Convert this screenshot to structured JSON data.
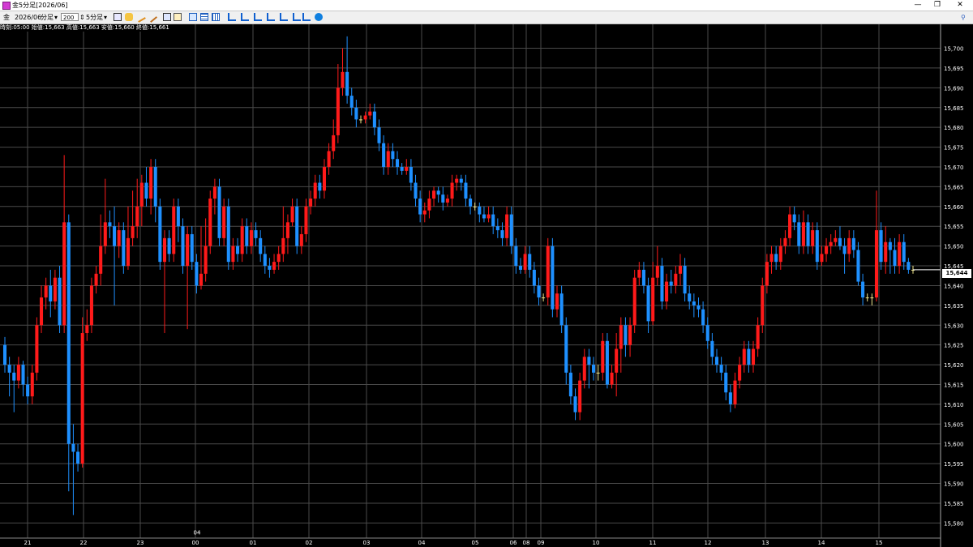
{
  "window": {
    "title": "金5分足[2026/06]",
    "minimize": "—",
    "restore": "❐",
    "close": "✕"
  },
  "toolbar": {
    "symbol": "金",
    "contract": "2026/06",
    "unit": "分足",
    "count": "200",
    "timeframe": "5分足",
    "icons": [
      "cursor-icon",
      "hand-icon",
      "pencil-icon",
      "line-icon",
      "select-icon",
      "edit-icon",
      "grid-icon",
      "table-icon",
      "bar-chart-icon",
      "bar-chart-icon-2",
      "bar-chart-icon-3",
      "bar-chart-icon-4",
      "bar-chart-icon-5",
      "refresh-icon",
      "settings-icon"
    ]
  },
  "info": {
    "text": "時刻:05:00 始値:15,663 高値:15,663 安値:15,660 終値:15,661"
  },
  "colors": {
    "background": "#000000",
    "grid": "#4a4a4a",
    "up": "#ff1a1a",
    "down": "#1e90ff",
    "doji": "#f0e68c"
  },
  "chart_data": {
    "type": "candlestick",
    "title": "",
    "ylim": [
      15577,
      15704
    ],
    "y_ticks": [
      "15,580",
      "15,585",
      "15,590",
      "15,595",
      "15,600",
      "15,605",
      "15,610",
      "15,615",
      "15,620",
      "15,625",
      "15,630",
      "15,635",
      "15,640",
      "15,645",
      "15,650",
      "15,655",
      "15,660",
      "15,665",
      "15,670",
      "15,675",
      "15,680",
      "15,685",
      "15,690",
      "15,695",
      "15,700"
    ],
    "x_labels": [
      "21",
      "22",
      "23",
      "00",
      "01",
      "02",
      "03",
      "04",
      "05",
      "06",
      "08",
      "09",
      "10",
      "11",
      "12",
      "13",
      "14",
      "15"
    ],
    "x_sublabel": "04",
    "last_price": "15,644",
    "candles": [
      [
        15625,
        15620,
        15627,
        15618
      ],
      [
        15620,
        15618,
        15622,
        15612
      ],
      [
        15618,
        15616,
        15620,
        15608
      ],
      [
        15616,
        15620,
        15622,
        15614
      ],
      [
        15620,
        15615,
        15621,
        15612
      ],
      [
        15615,
        15612,
        15617,
        15610
      ],
      [
        15612,
        15618,
        15620,
        15610
      ],
      [
        15618,
        15630,
        15632,
        15616
      ],
      [
        15630,
        15637,
        15640,
        15628
      ],
      [
        15637,
        15640,
        15642,
        15634
      ],
      [
        15640,
        15636,
        15644,
        15632
      ],
      [
        15636,
        15642,
        15644,
        15634
      ],
      [
        15642,
        15630,
        15645,
        15628
      ],
      [
        15630,
        15656,
        15673,
        15628
      ],
      [
        15656,
        15600,
        15658,
        15588
      ],
      [
        15600,
        15598,
        15605,
        15582
      ],
      [
        15598,
        15595,
        15600,
        15593
      ],
      [
        15595,
        15628,
        15632,
        15594
      ],
      [
        15628,
        15630,
        15634,
        15626
      ],
      [
        15630,
        15640,
        15642,
        15628
      ],
      [
        15640,
        15643,
        15645,
        15638
      ],
      [
        15643,
        15650,
        15658,
        15640
      ],
      [
        15650,
        15656,
        15667,
        15648
      ],
      [
        15656,
        15655,
        15659,
        15652
      ],
      [
        15655,
        15650,
        15660,
        15635
      ],
      [
        15650,
        15654,
        15656,
        15647
      ],
      [
        15654,
        15645,
        15656,
        15643
      ],
      [
        15645,
        15652,
        15660,
        15644
      ],
      [
        15652,
        15655,
        15664,
        15650
      ],
      [
        15655,
        15660,
        15667,
        15652
      ],
      [
        15660,
        15666,
        15668,
        15655
      ],
      [
        15666,
        15662,
        15670,
        15660
      ],
      [
        15662,
        15670,
        15672,
        15658
      ],
      [
        15670,
        15660,
        15672,
        15656
      ],
      [
        15660,
        15646,
        15662,
        15644
      ],
      [
        15646,
        15652,
        15654,
        15628
      ],
      [
        15652,
        15648,
        15654,
        15646
      ],
      [
        15648,
        15660,
        15662,
        15646
      ],
      [
        15660,
        15655,
        15662,
        15651
      ],
      [
        15655,
        15645,
        15657,
        15643
      ],
      [
        15645,
        15653,
        15655,
        15629
      ],
      [
        15653,
        15646,
        15655,
        15644
      ],
      [
        15646,
        15640,
        15648,
        15638
      ],
      [
        15640,
        15643,
        15655,
        15639
      ],
      [
        15643,
        15650,
        15657,
        15641
      ],
      [
        15650,
        15662,
        15664,
        15648
      ],
      [
        15662,
        15665,
        15667,
        15658
      ],
      [
        15665,
        15652,
        15667,
        15650
      ],
      [
        15652,
        15660,
        15662,
        15650
      ],
      [
        15660,
        15646,
        15662,
        15644
      ],
      [
        15646,
        15650,
        15652,
        15644
      ],
      [
        15650,
        15648,
        15652,
        15646
      ],
      [
        15648,
        15655,
        15657,
        15646
      ],
      [
        15655,
        15650,
        15657,
        15648
      ],
      [
        15650,
        15654,
        15656,
        15648
      ],
      [
        15654,
        15652,
        15656,
        15650
      ],
      [
        15652,
        15648,
        15654,
        15646
      ],
      [
        15648,
        15645,
        15650,
        15643
      ],
      [
        15645,
        15644,
        15647,
        15642
      ],
      [
        15644,
        15646,
        15648,
        15643
      ],
      [
        15646,
        15648,
        15650,
        15644
      ],
      [
        15648,
        15652,
        15660,
        15646
      ],
      [
        15652,
        15656,
        15658,
        15648
      ],
      [
        15656,
        15660,
        15662,
        15655
      ],
      [
        15660,
        15650,
        15662,
        15648
      ],
      [
        15650,
        15653,
        15655,
        15648
      ],
      [
        15653,
        15660,
        15662,
        15651
      ],
      [
        15660,
        15662,
        15664,
        15658
      ],
      [
        15662,
        15666,
        15668,
        15660
      ],
      [
        15666,
        15664,
        15668,
        15662
      ],
      [
        15664,
        15670,
        15672,
        15662
      ],
      [
        15670,
        15674,
        15676,
        15668
      ],
      [
        15674,
        15678,
        15682,
        15672
      ],
      [
        15678,
        15690,
        15696,
        15676
      ],
      [
        15690,
        15694,
        15700,
        15688
      ],
      [
        15694,
        15688,
        15703,
        15686
      ],
      [
        15688,
        15685,
        15690,
        15683
      ],
      [
        15685,
        15682,
        15687,
        15680
      ],
      [
        15682,
        15682,
        15683,
        15681
      ],
      [
        15682,
        15683,
        15684,
        15681
      ],
      [
        15683,
        15684,
        15686,
        15682
      ],
      [
        15684,
        15680,
        15686,
        15678
      ],
      [
        15680,
        15676,
        15682,
        15674
      ],
      [
        15676,
        15670,
        15678,
        15668
      ],
      [
        15670,
        15674,
        15676,
        15668
      ],
      [
        15674,
        15672,
        15676,
        15670
      ],
      [
        15672,
        15670,
        15674,
        15668
      ],
      [
        15670,
        15669,
        15671,
        15668
      ],
      [
        15669,
        15670,
        15672,
        15668
      ],
      [
        15670,
        15666,
        15672,
        15664
      ],
      [
        15666,
        15662,
        15668,
        15660
      ],
      [
        15662,
        15658,
        15664,
        15656
      ],
      [
        15658,
        15659,
        15661,
        15656
      ],
      [
        15659,
        15662,
        15664,
        15657
      ],
      [
        15662,
        15664,
        15665,
        15660
      ],
      [
        15664,
        15663,
        15665,
        15661
      ],
      [
        15663,
        15661,
        15665,
        15659
      ],
      [
        15661,
        15662,
        15663,
        15660
      ],
      [
        15662,
        15666,
        15668,
        15660
      ],
      [
        15666,
        15667,
        15668,
        15664
      ],
      [
        15667,
        15666,
        15668,
        15664
      ],
      [
        15666,
        15662,
        15668,
        15660
      ],
      [
        15662,
        15660,
        15663,
        15658
      ],
      [
        15660,
        15660,
        15661,
        15659
      ],
      [
        15660,
        15658,
        15661,
        15656
      ],
      [
        15658,
        15657,
        15660,
        15656
      ],
      [
        15657,
        15658,
        15660,
        15656
      ],
      [
        15658,
        15655,
        15660,
        15653
      ],
      [
        15655,
        15654,
        15657,
        15652
      ],
      [
        15654,
        15652,
        15656,
        15650
      ],
      [
        15652,
        15658,
        15660,
        15650
      ],
      [
        15658,
        15650,
        15660,
        15648
      ],
      [
        15650,
        15645,
        15652,
        15643
      ],
      [
        15645,
        15644,
        15647,
        15643
      ],
      [
        15644,
        15648,
        15650,
        15643
      ],
      [
        15648,
        15644,
        15650,
        15642
      ],
      [
        15644,
        15640,
        15646,
        15638
      ],
      [
        15640,
        15637,
        15642,
        15635
      ],
      [
        15637,
        15637,
        15638,
        15636
      ],
      [
        15637,
        15650,
        15652,
        15635
      ],
      [
        15650,
        15634,
        15652,
        15632
      ],
      [
        15634,
        15638,
        15640,
        15632
      ],
      [
        15638,
        15630,
        15640,
        15628
      ],
      [
        15630,
        15618,
        15632,
        15615
      ],
      [
        15618,
        15612,
        15620,
        15610
      ],
      [
        15612,
        15608,
        15614,
        15606
      ],
      [
        15608,
        15616,
        15618,
        15606
      ],
      [
        15616,
        15622,
        15624,
        15614
      ],
      [
        15622,
        15620,
        15624,
        15614
      ],
      [
        15620,
        15618,
        15622,
        15616
      ],
      [
        15618,
        15618,
        15620,
        15616
      ],
      [
        15618,
        15626,
        15628,
        15616
      ],
      [
        15626,
        15615,
        15628,
        15614
      ],
      [
        15615,
        15618,
        15620,
        15614
      ],
      [
        15618,
        15624,
        15628,
        15612
      ],
      [
        15624,
        15630,
        15632,
        15618
      ],
      [
        15630,
        15625,
        15632,
        15622
      ],
      [
        15625,
        15630,
        15632,
        15622
      ],
      [
        15630,
        15642,
        15644,
        15628
      ],
      [
        15642,
        15644,
        15646,
        15640
      ],
      [
        15644,
        15640,
        15646,
        15638
      ],
      [
        15640,
        15631,
        15642,
        15628
      ],
      [
        15631,
        15642,
        15646,
        15630
      ],
      [
        15642,
        15645,
        15650,
        15640
      ],
      [
        15645,
        15636,
        15647,
        15634
      ],
      [
        15636,
        15641,
        15643,
        15634
      ],
      [
        15641,
        15640,
        15644,
        15638
      ],
      [
        15640,
        15643,
        15645,
        15638
      ],
      [
        15643,
        15645,
        15648,
        15640
      ],
      [
        15645,
        15638,
        15647,
        15636
      ],
      [
        15638,
        15636,
        15640,
        15634
      ],
      [
        15636,
        15635,
        15638,
        15632
      ],
      [
        15635,
        15634,
        15637,
        15632
      ],
      [
        15634,
        15630,
        15636,
        15628
      ],
      [
        15630,
        15626,
        15632,
        15624
      ],
      [
        15626,
        15622,
        15628,
        15620
      ],
      [
        15622,
        15620,
        15624,
        15618
      ],
      [
        15620,
        15618,
        15622,
        15616
      ],
      [
        15618,
        15613,
        15620,
        15611
      ],
      [
        15613,
        15610,
        15615,
        15608
      ],
      [
        15610,
        15616,
        15618,
        15609
      ],
      [
        15616,
        15620,
        15622,
        15614
      ],
      [
        15620,
        15624,
        15626,
        15618
      ],
      [
        15624,
        15620,
        15626,
        15618
      ],
      [
        15620,
        15624,
        15626,
        15618
      ],
      [
        15624,
        15630,
        15632,
        15622
      ],
      [
        15630,
        15640,
        15642,
        15628
      ],
      [
        15640,
        15646,
        15648,
        15638
      ],
      [
        15646,
        15648,
        15650,
        15643
      ],
      [
        15648,
        15646,
        15650,
        15644
      ],
      [
        15646,
        15650,
        15652,
        15644
      ],
      [
        15650,
        15652,
        15654,
        15648
      ],
      [
        15652,
        15658,
        15660,
        15650
      ],
      [
        15658,
        15656,
        15660,
        15654
      ],
      [
        15656,
        15650,
        15658,
        15648
      ],
      [
        15650,
        15656,
        15659,
        15648
      ],
      [
        15656,
        15650,
        15658,
        15648
      ],
      [
        15650,
        15654,
        15656,
        15648
      ],
      [
        15654,
        15646,
        15656,
        15644
      ],
      [
        15646,
        15648,
        15650,
        15645
      ],
      [
        15648,
        15650,
        15652,
        15646
      ],
      [
        15650,
        15651,
        15653,
        15648
      ],
      [
        15651,
        15652,
        15654,
        15650
      ],
      [
        15652,
        15650,
        15655,
        15649
      ],
      [
        15650,
        15648,
        15652,
        15643
      ],
      [
        15648,
        15652,
        15654,
        15646
      ],
      [
        15652,
        15649,
        15654,
        15647
      ],
      [
        15649,
        15641,
        15651,
        15640
      ],
      [
        15641,
        15637,
        15643,
        15635
      ],
      [
        15637,
        15637,
        15638,
        15636
      ],
      [
        15637,
        15637,
        15638,
        15635
      ],
      [
        15637,
        15654,
        15664,
        15636
      ],
      [
        15654,
        15646,
        15656,
        15644
      ],
      [
        15646,
        15651,
        15655,
        15643
      ],
      [
        15651,
        15649,
        15652,
        15643
      ],
      [
        15649,
        15645,
        15652,
        15643
      ],
      [
        15645,
        15651,
        15653,
        15643
      ],
      [
        15651,
        15646,
        15653,
        15644
      ],
      [
        15646,
        15644,
        15647,
        15643
      ],
      [
        15644,
        15644,
        15645,
        15643
      ]
    ]
  }
}
